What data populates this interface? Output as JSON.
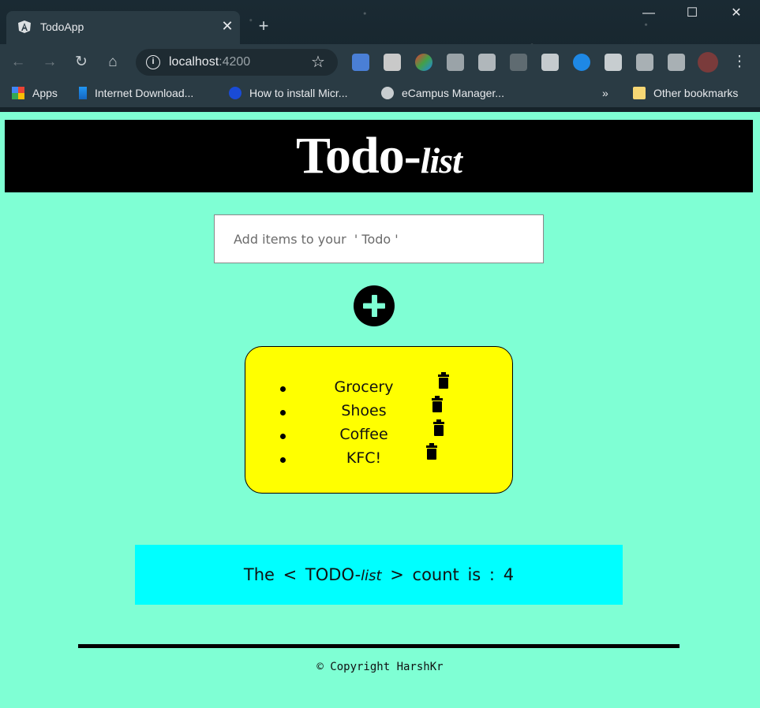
{
  "browser": {
    "tab_title": "TodoApp",
    "tab_favicon": "angular-icon",
    "url_host": "localhost",
    "url_port": ":4200",
    "bookmarks": [
      {
        "label": "Apps",
        "icon": "apps-grid-icon"
      },
      {
        "label": "Internet Download...",
        "icon": "download-manager-icon"
      },
      {
        "label": "How to install Micr...",
        "icon": "globe-blue-icon"
      },
      {
        "label": "eCampus Manager...",
        "icon": "globe-icon"
      }
    ],
    "overflow_label": "»",
    "other_bookmarks_label": "Other bookmarks"
  },
  "header": {
    "title_main": "Todo-",
    "title_italic": "list"
  },
  "input": {
    "placeholder": "Add items to your  ' Todo '",
    "value": ""
  },
  "add_button": {
    "icon": "plus-icon",
    "icon_color": "#7fffd4"
  },
  "todos": [
    {
      "text": "Grocery"
    },
    {
      "text": "Shoes"
    },
    {
      "text": "Coffee"
    },
    {
      "text": "KFC!"
    }
  ],
  "counter": {
    "prefix": "The  <  TODO-",
    "italic": "list",
    "suffix": "  >  count  is  :",
    "count": "4"
  },
  "footer": {
    "copyright": "© Copyright HarshKr"
  },
  "colors": {
    "page_bg": "#7fffd4",
    "header_bg": "#000000",
    "list_bg": "#ffff00",
    "count_bg": "#00ffff"
  }
}
